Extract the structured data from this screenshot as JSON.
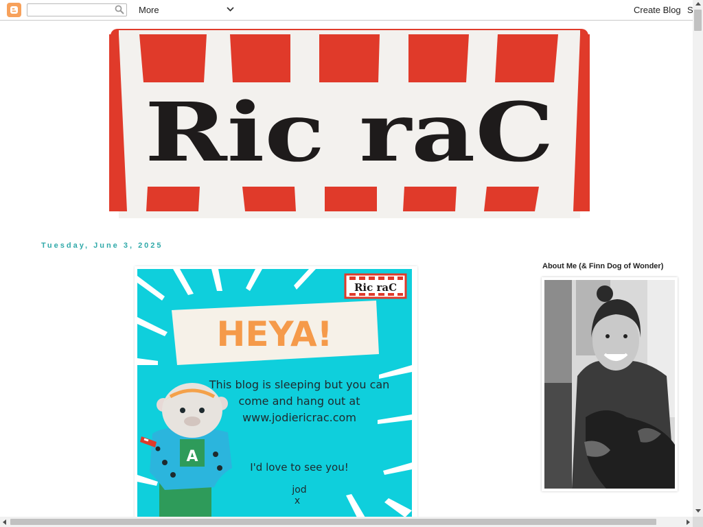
{
  "navbar": {
    "more_label": "More",
    "create_blog_label": "Create Blog",
    "signin_label": "Sign In",
    "search_placeholder": ""
  },
  "header": {
    "title": "Ric raC"
  },
  "post": {
    "date": "Tuesday, June 3, 2025",
    "image": {
      "logo_text": "Ric raC",
      "heading": "HEYA!",
      "line1": "This blog is sleeping but you can",
      "line2": "come and hang out at",
      "line3": "www.jodiericrac.com",
      "line4": "I'd love to see you!",
      "sign": "jod",
      "kiss": "x",
      "toy_letter": "A"
    }
  },
  "sidebar": {
    "about_title": "About Me (& Finn Dog of Wonder)"
  },
  "colors": {
    "banner_red": "#e03a2a",
    "banner_bg": "#f3f1ee",
    "post_cyan": "#0fcfdc",
    "heading_orange": "#f59a4a",
    "date_teal": "#2fa9a9",
    "blogger_orange": "#f7a15b"
  },
  "icons": {
    "logo": "blogger-icon",
    "search": "search-icon",
    "more": "chevron-down-icon"
  }
}
